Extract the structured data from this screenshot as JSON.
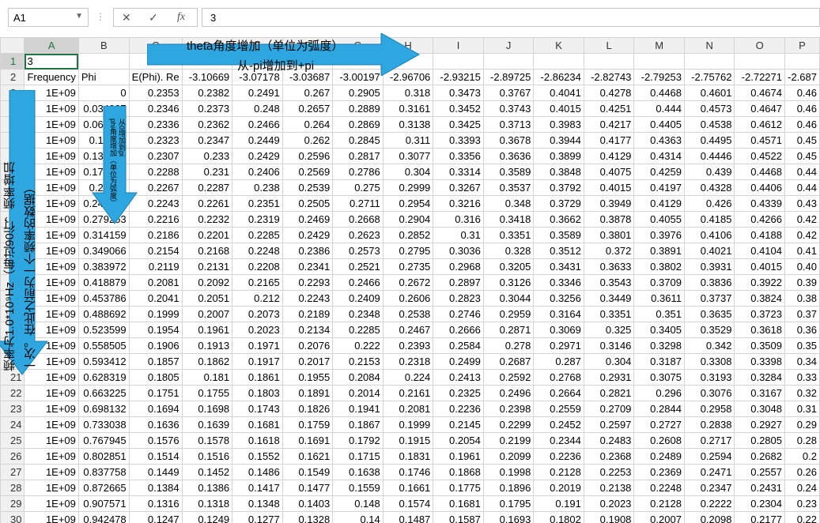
{
  "formula_bar": {
    "name_box": "A1",
    "cancel_icon": "✕",
    "enter_icon": "✓",
    "fx_label": "fx",
    "value": "3"
  },
  "columns": [
    "A",
    "B",
    "C",
    "D",
    "E",
    "F",
    "G",
    "H",
    "I",
    "J",
    "K",
    "L",
    "M",
    "N",
    "O",
    "P"
  ],
  "rows": [
    {
      "n": "1",
      "cells": [
        "3",
        "",
        "",
        "",
        "",
        "",
        "",
        "",
        "",
        "",
        "",
        "",
        "",
        "",
        "",
        ""
      ]
    },
    {
      "n": "2",
      "cells": [
        "Frequency",
        "Phi",
        "E(Phi). Re",
        "-3.10669",
        "-3.07178",
        "-3.03687",
        "-3.00197",
        "-2.96706",
        "-2.93215",
        "-2.89725",
        "-2.86234",
        "-2.82743",
        "-2.79253",
        "-2.75762",
        "-2.72271",
        "-2.687"
      ]
    },
    {
      "n": "3",
      "cells": [
        "1E+09",
        "0",
        "0.2353",
        "0.2382",
        "0.2491",
        "0.267",
        "0.2905",
        "0.318",
        "0.3473",
        "0.3767",
        "0.4041",
        "0.4278",
        "0.4468",
        "0.4601",
        "0.4674",
        "0.46"
      ]
    },
    {
      "n": "4",
      "cells": [
        "1E+09",
        "0.034907",
        "0.2346",
        "0.2373",
        "0.248",
        "0.2657",
        "0.2889",
        "0.3161",
        "0.3452",
        "0.3743",
        "0.4015",
        "0.4251",
        "0.444",
        "0.4573",
        "0.4647",
        "0.46"
      ]
    },
    {
      "n": "5",
      "cells": [
        "1E+09",
        "0.069813",
        "0.2336",
        "0.2362",
        "0.2466",
        "0.264",
        "0.2869",
        "0.3138",
        "0.3425",
        "0.3713",
        "0.3983",
        "0.4217",
        "0.4405",
        "0.4538",
        "0.4612",
        "0.46"
      ]
    },
    {
      "n": "6",
      "cells": [
        "1E+09",
        "0.10472",
        "0.2323",
        "0.2347",
        "0.2449",
        "0.262",
        "0.2845",
        "0.311",
        "0.3393",
        "0.3678",
        "0.3944",
        "0.4177",
        "0.4363",
        "0.4495",
        "0.4571",
        "0.45"
      ]
    },
    {
      "n": "7",
      "cells": [
        "1E+09",
        "0.139626",
        "0.2307",
        "0.233",
        "0.2429",
        "0.2596",
        "0.2817",
        "0.3077",
        "0.3356",
        "0.3636",
        "0.3899",
        "0.4129",
        "0.4314",
        "0.4446",
        "0.4522",
        "0.45"
      ]
    },
    {
      "n": "8",
      "cells": [
        "1E+09",
        "0.174533",
        "0.2288",
        "0.231",
        "0.2406",
        "0.2569",
        "0.2786",
        "0.304",
        "0.3314",
        "0.3589",
        "0.3848",
        "0.4075",
        "0.4259",
        "0.439",
        "0.4468",
        "0.44"
      ]
    },
    {
      "n": "9",
      "cells": [
        "1E+09",
        "0.20944",
        "0.2267",
        "0.2287",
        "0.238",
        "0.2539",
        "0.275",
        "0.2999",
        "0.3267",
        "0.3537",
        "0.3792",
        "0.4015",
        "0.4197",
        "0.4328",
        "0.4406",
        "0.44"
      ]
    },
    {
      "n": "10",
      "cells": [
        "1E+09",
        "0.244346",
        "0.2243",
        "0.2261",
        "0.2351",
        "0.2505",
        "0.2711",
        "0.2954",
        "0.3216",
        "0.348",
        "0.3729",
        "0.3949",
        "0.4129",
        "0.426",
        "0.4339",
        "0.43"
      ]
    },
    {
      "n": "11",
      "cells": [
        "1E+09",
        "0.279253",
        "0.2216",
        "0.2232",
        "0.2319",
        "0.2469",
        "0.2668",
        "0.2904",
        "0.316",
        "0.3418",
        "0.3662",
        "0.3878",
        "0.4055",
        "0.4185",
        "0.4266",
        "0.42"
      ]
    },
    {
      "n": "12",
      "cells": [
        "1E+09",
        "0.314159",
        "0.2186",
        "0.2201",
        "0.2285",
        "0.2429",
        "0.2623",
        "0.2852",
        "0.31",
        "0.3351",
        "0.3589",
        "0.3801",
        "0.3976",
        "0.4106",
        "0.4188",
        "0.42"
      ]
    },
    {
      "n": "13",
      "cells": [
        "1E+09",
        "0.349066",
        "0.2154",
        "0.2168",
        "0.2248",
        "0.2386",
        "0.2573",
        "0.2795",
        "0.3036",
        "0.328",
        "0.3512",
        "0.372",
        "0.3891",
        "0.4021",
        "0.4104",
        "0.41"
      ]
    },
    {
      "n": "14",
      "cells": [
        "1E+09",
        "0.383972",
        "0.2119",
        "0.2131",
        "0.2208",
        "0.2341",
        "0.2521",
        "0.2735",
        "0.2968",
        "0.3205",
        "0.3431",
        "0.3633",
        "0.3802",
        "0.3931",
        "0.4015",
        "0.40"
      ]
    },
    {
      "n": "15",
      "cells": [
        "1E+09",
        "0.418879",
        "0.2081",
        "0.2092",
        "0.2165",
        "0.2293",
        "0.2466",
        "0.2672",
        "0.2897",
        "0.3126",
        "0.3346",
        "0.3543",
        "0.3709",
        "0.3836",
        "0.3922",
        "0.39"
      ]
    },
    {
      "n": "16",
      "cells": [
        "1E+09",
        "0.453786",
        "0.2041",
        "0.2051",
        "0.212",
        "0.2243",
        "0.2409",
        "0.2606",
        "0.2823",
        "0.3044",
        "0.3256",
        "0.3449",
        "0.3611",
        "0.3737",
        "0.3824",
        "0.38"
      ]
    },
    {
      "n": "17",
      "cells": [
        "1E+09",
        "0.488692",
        "0.1999",
        "0.2007",
        "0.2073",
        "0.2189",
        "0.2348",
        "0.2538",
        "0.2746",
        "0.2959",
        "0.3164",
        "0.3351",
        "0.351",
        "0.3635",
        "0.3723",
        "0.37"
      ]
    },
    {
      "n": "18",
      "cells": [
        "1E+09",
        "0.523599",
        "0.1954",
        "0.1961",
        "0.2023",
        "0.2134",
        "0.2285",
        "0.2467",
        "0.2666",
        "0.2871",
        "0.3069",
        "0.325",
        "0.3405",
        "0.3529",
        "0.3618",
        "0.36"
      ]
    },
    {
      "n": "19",
      "cells": [
        "1E+09",
        "0.558505",
        "0.1906",
        "0.1913",
        "0.1971",
        "0.2076",
        "0.222",
        "0.2393",
        "0.2584",
        "0.278",
        "0.2971",
        "0.3146",
        "0.3298",
        "0.342",
        "0.3509",
        "0.35"
      ]
    },
    {
      "n": "20",
      "cells": [
        "1E+09",
        "0.593412",
        "0.1857",
        "0.1862",
        "0.1917",
        "0.2017",
        "0.2153",
        "0.2318",
        "0.2499",
        "0.2687",
        "0.287",
        "0.304",
        "0.3187",
        "0.3308",
        "0.3398",
        "0.34"
      ]
    },
    {
      "n": "21",
      "cells": [
        "1E+09",
        "0.628319",
        "0.1805",
        "0.181",
        "0.1861",
        "0.1955",
        "0.2084",
        "0.224",
        "0.2413",
        "0.2592",
        "0.2768",
        "0.2931",
        "0.3075",
        "0.3193",
        "0.3284",
        "0.33"
      ]
    },
    {
      "n": "22",
      "cells": [
        "1E+09",
        "0.663225",
        "0.1751",
        "0.1755",
        "0.1803",
        "0.1891",
        "0.2014",
        "0.2161",
        "0.2325",
        "0.2496",
        "0.2664",
        "0.2821",
        "0.296",
        "0.3076",
        "0.3167",
        "0.32"
      ]
    },
    {
      "n": "23",
      "cells": [
        "1E+09",
        "0.698132",
        "0.1694",
        "0.1698",
        "0.1743",
        "0.1826",
        "0.1941",
        "0.2081",
        "0.2236",
        "0.2398",
        "0.2559",
        "0.2709",
        "0.2844",
        "0.2958",
        "0.3048",
        "0.31"
      ]
    },
    {
      "n": "24",
      "cells": [
        "1E+09",
        "0.733038",
        "0.1636",
        "0.1639",
        "0.1681",
        "0.1759",
        "0.1867",
        "0.1999",
        "0.2145",
        "0.2299",
        "0.2452",
        "0.2597",
        "0.2727",
        "0.2838",
        "0.2927",
        "0.29"
      ]
    },
    {
      "n": "25",
      "cells": [
        "1E+09",
        "0.767945",
        "0.1576",
        "0.1578",
        "0.1618",
        "0.1691",
        "0.1792",
        "0.1915",
        "0.2054",
        "0.2199",
        "0.2344",
        "0.2483",
        "0.2608",
        "0.2717",
        "0.2805",
        "0.28"
      ]
    },
    {
      "n": "26",
      "cells": [
        "1E+09",
        "0.802851",
        "0.1514",
        "0.1516",
        "0.1552",
        "0.1621",
        "0.1715",
        "0.1831",
        "0.1961",
        "0.2099",
        "0.2236",
        "0.2368",
        "0.2489",
        "0.2594",
        "0.2682",
        "0.2"
      ]
    },
    {
      "n": "27",
      "cells": [
        "1E+09",
        "0.837758",
        "0.1449",
        "0.1452",
        "0.1486",
        "0.1549",
        "0.1638",
        "0.1746",
        "0.1868",
        "0.1998",
        "0.2128",
        "0.2253",
        "0.2369",
        "0.2471",
        "0.2557",
        "0.26"
      ]
    },
    {
      "n": "28",
      "cells": [
        "1E+09",
        "0.872665",
        "0.1384",
        "0.1386",
        "0.1417",
        "0.1477",
        "0.1559",
        "0.1661",
        "0.1775",
        "0.1896",
        "0.2019",
        "0.2138",
        "0.2248",
        "0.2347",
        "0.2431",
        "0.24"
      ]
    },
    {
      "n": "29",
      "cells": [
        "1E+09",
        "0.907571",
        "0.1316",
        "0.1318",
        "0.1348",
        "0.1403",
        "0.148",
        "0.1574",
        "0.1681",
        "0.1795",
        "0.191",
        "0.2023",
        "0.2128",
        "0.2222",
        "0.2304",
        "0.23"
      ]
    },
    {
      "n": "30",
      "cells": [
        "1E+09",
        "0.942478",
        "0.1247",
        "0.1249",
        "0.1277",
        "0.1328",
        "0.14",
        "0.1487",
        "0.1587",
        "0.1693",
        "0.1802",
        "0.1908",
        "0.2007",
        "0.2098",
        "0.2177",
        "0.22"
      ]
    }
  ],
  "annotations": {
    "theta_line1": "theta角度增加（单位为弧度）",
    "theta_line2": "从-pi增加到+pi",
    "phi_line1": "phi角度增加（单位为弧度）",
    "phi_line2": "从0增加到pi",
    "freq_line1": "频率为1.0*10⁹Hz（每过90行，频率增加",
    "freq_line2": "一次。在此之前为一个频率的数据）",
    "arrow_color": "#2ea6e0"
  }
}
